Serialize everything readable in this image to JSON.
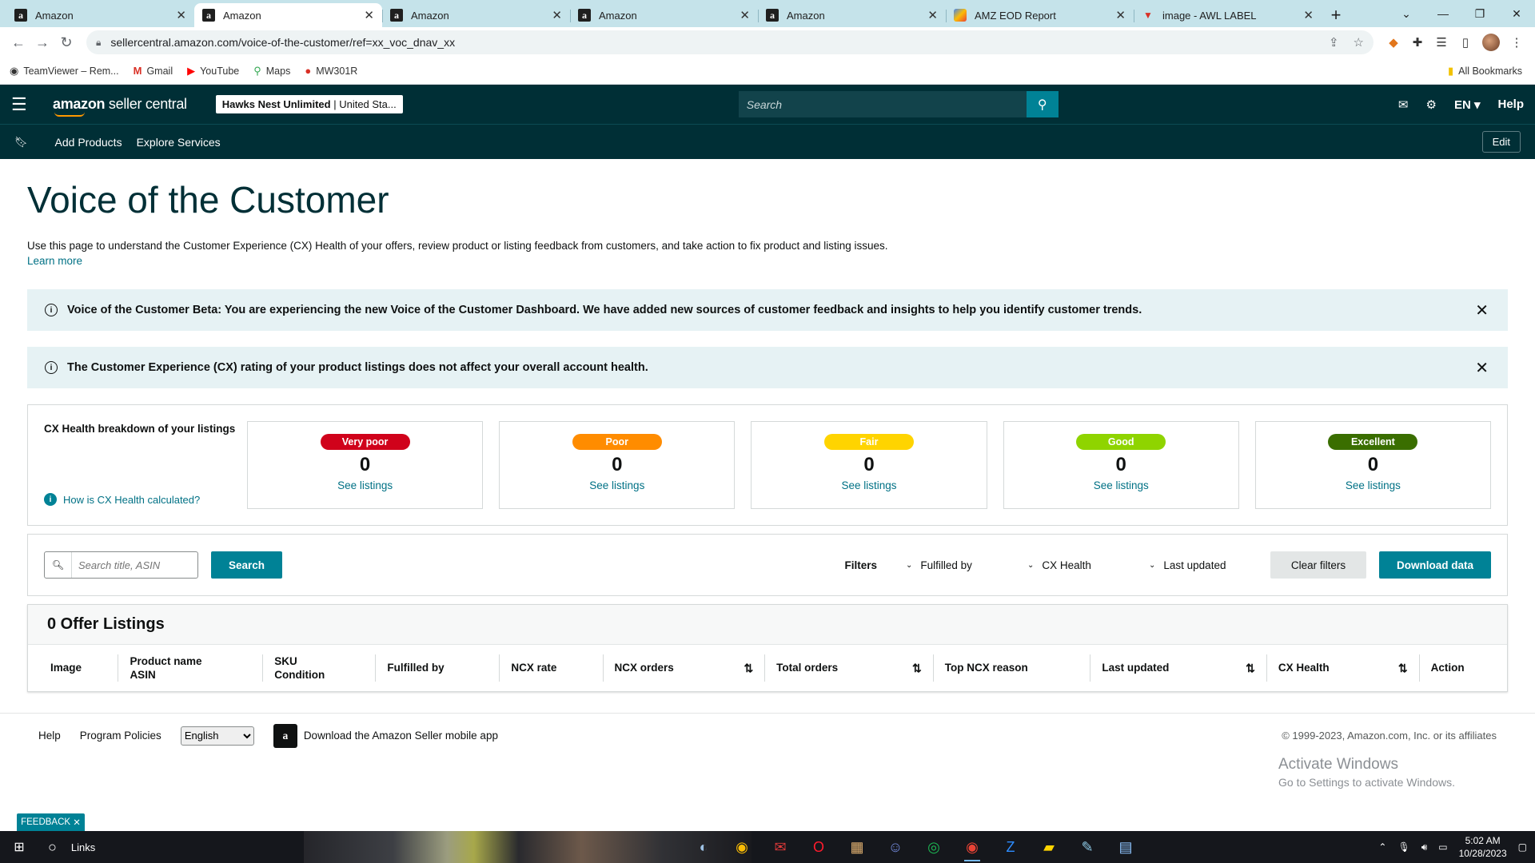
{
  "browser": {
    "tabs": [
      {
        "title": "Amazon",
        "favicon": "amazon-icon",
        "active": false
      },
      {
        "title": "Amazon",
        "favicon": "amazon-icon",
        "active": true
      },
      {
        "title": "Amazon",
        "favicon": "amazon-icon",
        "active": false
      },
      {
        "title": "Amazon",
        "favicon": "amazon-icon",
        "active": false
      },
      {
        "title": "Amazon",
        "favicon": "amazon-icon",
        "active": false
      },
      {
        "title": "AMZ EOD Report",
        "favicon": "report-icon",
        "active": false
      },
      {
        "title": "image - AWL LABEL",
        "favicon": "awl-icon",
        "active": false
      }
    ],
    "url": "sellercentral.amazon.com/voice-of-the-customer/ref=xx_voc_dnav_xx",
    "bookmarks": [
      {
        "label": "TeamViewer – Rem...",
        "icon": "teamviewer-icon"
      },
      {
        "label": "Gmail",
        "icon": "gmail-icon"
      },
      {
        "label": "YouTube",
        "icon": "youtube-icon"
      },
      {
        "label": "Maps",
        "icon": "maps-icon"
      },
      {
        "label": "MW301R",
        "icon": "mw-icon"
      }
    ],
    "all_bookmarks": "All Bookmarks"
  },
  "header": {
    "brand_bold": "amazon",
    "brand_thin": " seller central",
    "store_name": "Hawks Nest Unlimited",
    "store_region": " | United Sta...",
    "search_placeholder": "Search",
    "lang": "EN",
    "help": "Help"
  },
  "subnav": {
    "items": [
      "Add Products",
      "Explore Services"
    ],
    "edit": "Edit"
  },
  "page": {
    "title": "Voice of the Customer",
    "intro": "Use this page to understand the Customer Experience (CX) Health of your offers, review product or listing feedback from customers, and take action to fix product and listing issues.",
    "learn_more": "Learn more"
  },
  "alerts": [
    {
      "text": "Voice of the Customer Beta: You are experiencing the new Voice of the Customer Dashboard. We have added new sources of customer feedback and insights to help you identify customer trends."
    },
    {
      "text": "The Customer Experience (CX) rating of your product listings does not affect your overall account health."
    }
  ],
  "cx_health": {
    "label": "CX Health breakdown of your listings",
    "how_link": "How is CX Health calculated?",
    "cards": [
      {
        "badge": "Very poor",
        "count": "0",
        "link": "See listings",
        "color": "#d0021b",
        "text_color": "#ffffff"
      },
      {
        "badge": "Poor",
        "count": "0",
        "link": "See listings",
        "color": "#ff8c00",
        "text_color": "#ffffff"
      },
      {
        "badge": "Fair",
        "count": "0",
        "link": "See listings",
        "color": "#ffd400",
        "text_color": "#ffffff"
      },
      {
        "badge": "Good",
        "count": "0",
        "link": "See listings",
        "color": "#8fd400",
        "text_color": "#ffffff"
      },
      {
        "badge": "Excellent",
        "count": "0",
        "link": "See listings",
        "color": "#3a6e00",
        "text_color": "#ffffff"
      }
    ]
  },
  "filters": {
    "search_placeholder": "Search title, ASIN",
    "search_button": "Search",
    "label": "Filters",
    "dropdowns": [
      "Fulfilled by",
      "CX Health",
      "Last updated"
    ],
    "clear": "Clear filters",
    "download": "Download data"
  },
  "offers": {
    "title": "0 Offer Listings",
    "columns": [
      {
        "line1": "Image",
        "line2": "",
        "sortable": false
      },
      {
        "line1": "Product name",
        "line2": "ASIN",
        "sortable": false
      },
      {
        "line1": "SKU",
        "line2": "Condition",
        "sortable": false
      },
      {
        "line1": "Fulfilled by",
        "line2": "",
        "sortable": false
      },
      {
        "line1": "NCX rate",
        "line2": "",
        "sortable": false
      },
      {
        "line1": "NCX orders",
        "line2": "",
        "sortable": true
      },
      {
        "line1": "Total orders",
        "line2": "",
        "sortable": true
      },
      {
        "line1": "Top NCX reason",
        "line2": "",
        "sortable": false
      },
      {
        "line1": "Last updated",
        "line2": "",
        "sortable": true
      },
      {
        "line1": "CX Health",
        "line2": "",
        "sortable": true
      },
      {
        "line1": "Action",
        "line2": "",
        "sortable": false
      }
    ]
  },
  "footer": {
    "help": "Help",
    "policies": "Program Policies",
    "language": "English",
    "app_text": "Download the Amazon Seller mobile app",
    "copyright": "© 1999-2023, Amazon.com, Inc. or its affiliates"
  },
  "watermark": {
    "line1": "Activate Windows",
    "line2": "Go to Settings to activate Windows."
  },
  "feedback": "FEEDBACK",
  "taskbar": {
    "search": "Links",
    "time": "5:02 AM",
    "date": "10/28/2023",
    "apps": [
      "steam-icon",
      "chrome-icon",
      "mail-app-icon",
      "opera-icon",
      "photo-app-icon",
      "discord-icon",
      "spotify-icon",
      "chrome-profile-icon",
      "zoom-icon",
      "sticky-notes-icon",
      "notepad-icon",
      "calculator-icon"
    ]
  }
}
